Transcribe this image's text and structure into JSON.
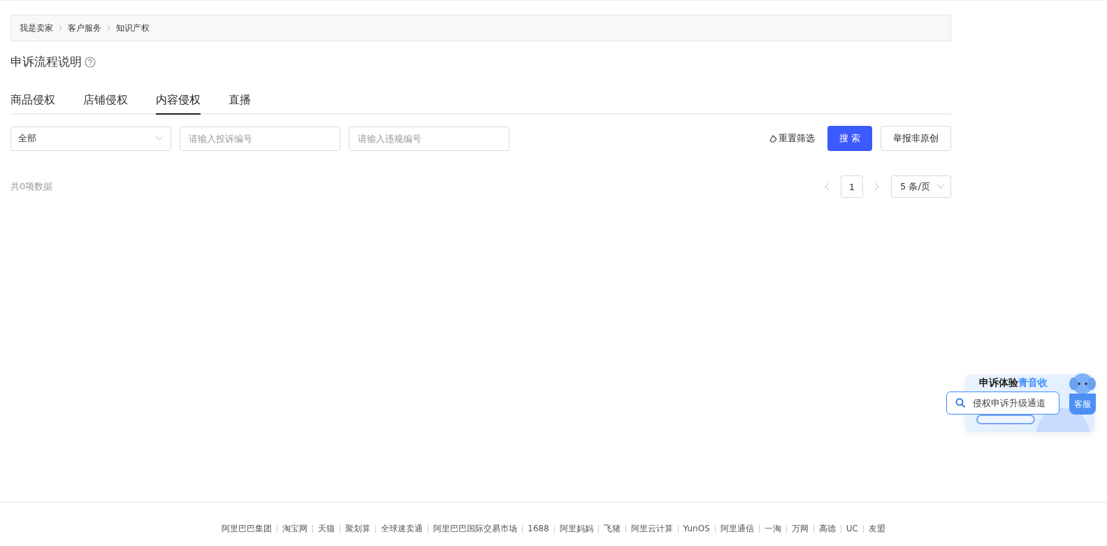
{
  "breadcrumb": [
    "我是卖家",
    "客户服务",
    "知识产权"
  ],
  "title": "申诉流程说明",
  "tabs": [
    {
      "label": "商品侵权",
      "selected": false
    },
    {
      "label": "店铺侵权",
      "selected": false
    },
    {
      "label": "内容侵权",
      "selected": true
    },
    {
      "label": "直播",
      "selected": false
    }
  ],
  "filters": {
    "select": "全部",
    "complaint_placeholder": "请输入投诉编号",
    "violation_placeholder": "请输入违规编号",
    "reset": "重置筛选",
    "search": "搜 索",
    "report": "举报非原创"
  },
  "total": "共0项数据",
  "pagination": {
    "page": "1",
    "page_size": "5 条/页"
  },
  "widget": {
    "title": "申诉体验",
    "title_highlight": "青音收",
    "search": "侵权申诉升级通道",
    "service": "客服"
  },
  "footer_links": [
    "阿里巴巴集团",
    "淘宝网",
    "天猫",
    "聚划算",
    "全球速卖通",
    "阿里巴巴国际交易市场",
    "1688",
    "阿里妈妈",
    "飞猪",
    "阿里云计算",
    "YunOS",
    "阿里通信",
    "一淘",
    "万网",
    "高德",
    "UC",
    "友盟"
  ]
}
